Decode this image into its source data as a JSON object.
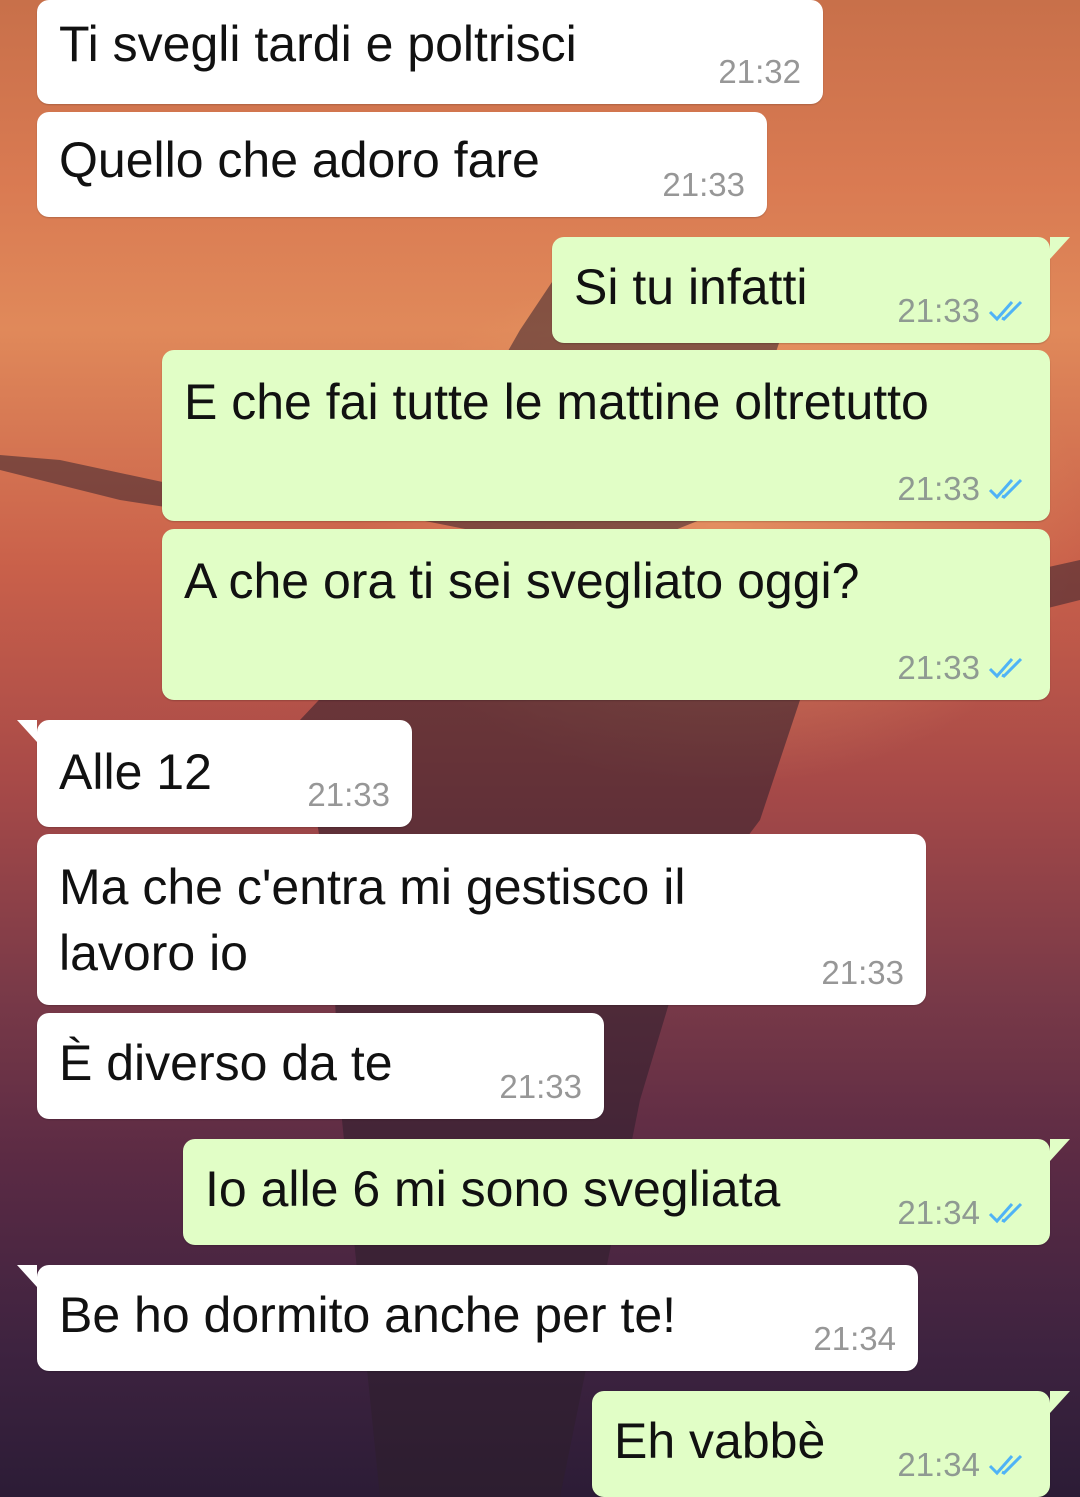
{
  "colors": {
    "incoming_bubble": "#ffffff",
    "outgoing_bubble": "#e1fec6",
    "read_ticks": "#4fb3f6",
    "timestamp": "#979797"
  },
  "messages": [
    {
      "direction": "incoming",
      "text": "Ti svegli tardi e poltrisci",
      "time": "21:32"
    },
    {
      "direction": "incoming",
      "text": "Quello che adoro fare",
      "time": "21:33"
    },
    {
      "direction": "outgoing",
      "text": "Si tu infatti",
      "time": "21:33",
      "status": "read",
      "status_icon": "double-check-icon"
    },
    {
      "direction": "outgoing",
      "text": "E che fai tutte le mattine oltretutto",
      "time": "21:33",
      "status": "read",
      "status_icon": "double-check-icon"
    },
    {
      "direction": "outgoing",
      "text": "A che ora ti sei svegliato oggi?",
      "time": "21:33",
      "status": "read",
      "status_icon": "double-check-icon"
    },
    {
      "direction": "incoming",
      "text": "Alle 12",
      "time": "21:33"
    },
    {
      "direction": "incoming",
      "text": "Ma che c'entra mi gestisco il lavoro io",
      "time": "21:33"
    },
    {
      "direction": "incoming",
      "text": "È diverso da te",
      "time": "21:33"
    },
    {
      "direction": "outgoing",
      "text": "Io alle 6 mi sono svegliata",
      "time": "21:34",
      "status": "read",
      "status_icon": "double-check-icon"
    },
    {
      "direction": "incoming",
      "text": "Be ho dormito anche per te!",
      "time": "21:34"
    },
    {
      "direction": "outgoing",
      "text": "Eh vabbè",
      "time": "21:34",
      "status": "read",
      "status_icon": "double-check-icon"
    }
  ]
}
